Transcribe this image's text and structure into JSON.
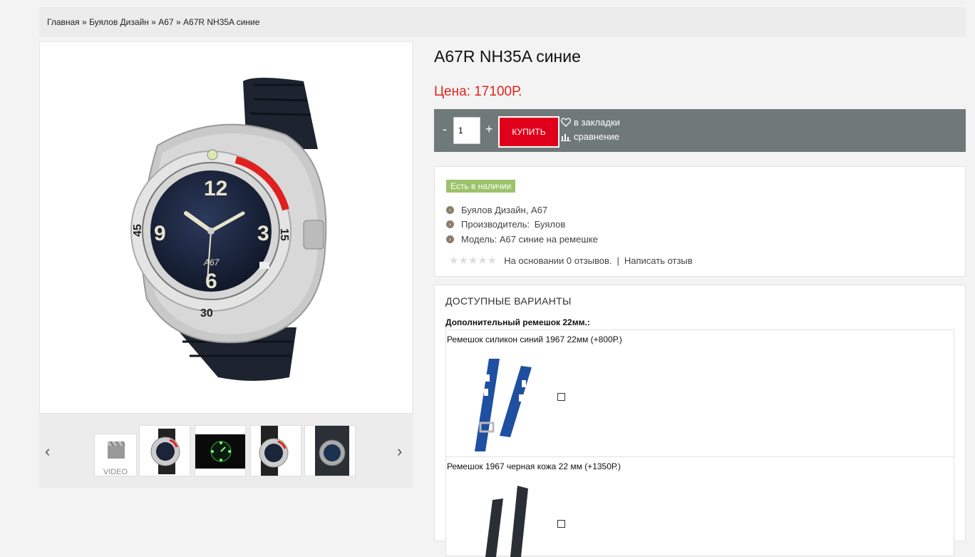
{
  "breadcrumb": {
    "items": [
      "Главная",
      "Буялов Дизайн",
      "А67",
      "А67R NH35A синие"
    ],
    "separator": "»"
  },
  "gallery": {
    "video_label": "VIDEO",
    "prev_label": "‹",
    "next_label": "›"
  },
  "product": {
    "title": "А67R NH35A синие",
    "price": "Цена: 17100Р."
  },
  "buy": {
    "minus": "-",
    "qty": "1",
    "plus": "+",
    "button": "купить",
    "bookmark": "в закладки",
    "compare": "сравнение"
  },
  "info": {
    "stock": "Есть в наличии",
    "category": "Буялов Дизайн, А67",
    "manufacturer_label": "Производитель: ",
    "manufacturer": "Буялов",
    "model": "Модель: А67 синие на ремешке",
    "reviews": "На основании 0 отзывов.",
    "review_sep": "|",
    "write_review": "Написать отзыв",
    "stars": "★★★★★"
  },
  "variants": {
    "heading": "ДОСТУПНЫЕ ВАРИАНТЫ",
    "group_label": "Дополнительный ремешок 22мм.:",
    "options": [
      {
        "label": "Ремешок силикон синий 1967 22мм (+800Р.)"
      },
      {
        "label": "Ремешок 1967 черная кожа 22 мм (+1350Р.)"
      }
    ]
  },
  "colors": {
    "price": "#e0241b",
    "buy_button": "#e0001b",
    "buy_bar": "#707979",
    "stock_badge": "#9cc26a"
  }
}
